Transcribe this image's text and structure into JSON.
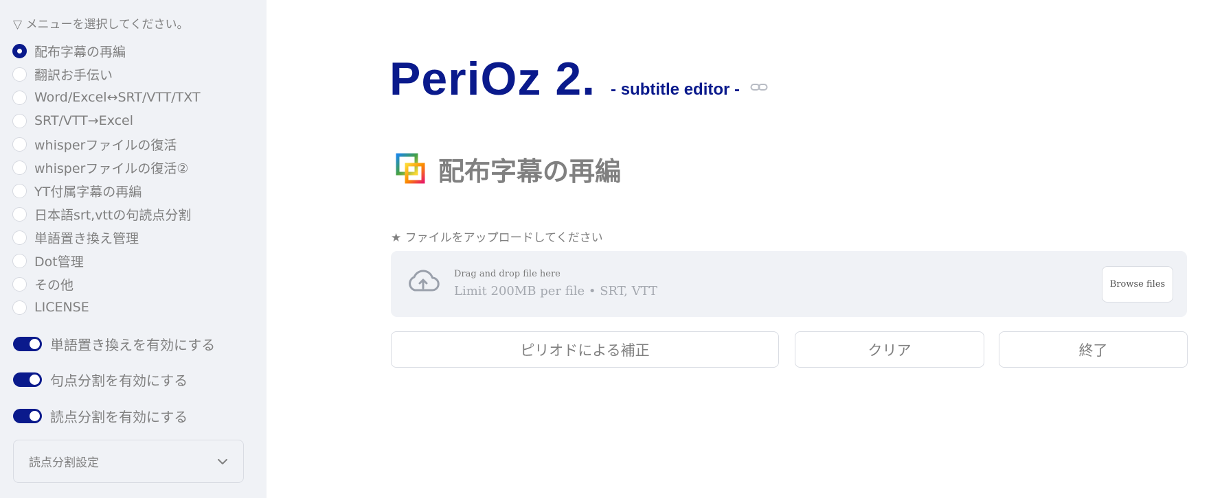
{
  "sidebar": {
    "menu_caption": "▽ メニューを選択してください。",
    "menu_items": [
      {
        "label": "配布字幕の再編",
        "selected": true
      },
      {
        "label": "翻訳お手伝い",
        "selected": false
      },
      {
        "label": "Word/Excel↔SRT/VTT/TXT",
        "selected": false
      },
      {
        "label": "SRT/VTT→Excel",
        "selected": false
      },
      {
        "label": "whisperファイルの復活",
        "selected": false
      },
      {
        "label": "whisperファイルの復活②",
        "selected": false
      },
      {
        "label": "YT付属字幕の再編",
        "selected": false
      },
      {
        "label": "日本語srt,vttの句読点分割",
        "selected": false
      },
      {
        "label": "単語置き換え管理",
        "selected": false
      },
      {
        "label": "Dot管理",
        "selected": false
      },
      {
        "label": "その他",
        "selected": false
      },
      {
        "label": "LICENSE",
        "selected": false
      }
    ],
    "toggles": [
      {
        "label": "単語置き換えを有効にする",
        "on": true
      },
      {
        "label": "句点分割を有効にする",
        "on": true
      },
      {
        "label": "読点分割を有効にする",
        "on": true
      }
    ],
    "expander": {
      "label": "読点分割設定",
      "icon": "chevron-down-icon"
    }
  },
  "header": {
    "title": "PeriOz 2.",
    "subtitle": "- subtitle editor -",
    "link_icon": "link-icon"
  },
  "section": {
    "title": "配布字幕の再編",
    "icon": "overlapping-squares-icon"
  },
  "uploader": {
    "caption": "★ ファイルをアップロードしてください",
    "drop_text": "Drag and drop file here",
    "limit_text": "Limit 200MB per file • SRT, VTT",
    "browse_label": "Browse files",
    "icon": "cloud-upload-icon"
  },
  "actions": {
    "period_fix": "ピリオドによる補正",
    "clear": "クリア",
    "exit": "終了"
  },
  "colors": {
    "accent": "#0a1a8c",
    "sidebar_bg": "#f0f2f6",
    "text": "#808080"
  }
}
